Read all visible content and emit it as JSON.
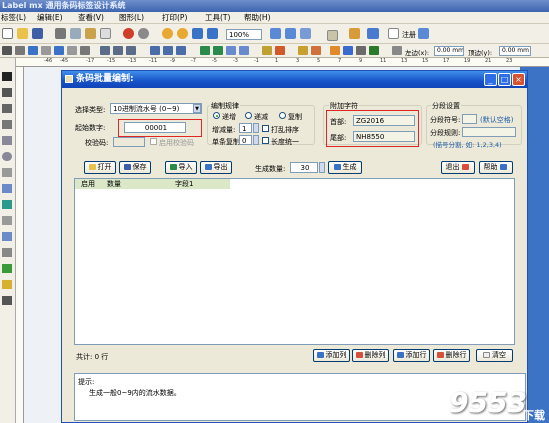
{
  "app": {
    "title": "Label mx 通用条码标签设计系统",
    "menus": [
      "标签(L)",
      "编辑(E)",
      "查看(V)",
      "图形(L)",
      "打印(P)",
      "工具(T)",
      "帮助(H)"
    ],
    "zoom": "100%",
    "register_label": "注册",
    "left_label": "左边(x):",
    "left_value": "0.00 mm",
    "top_label": "顶边(y):",
    "top_value": "0.00 mm",
    "ruler_ticks": [
      "-46",
      "-45",
      "-17",
      "-15",
      "-13",
      "-11",
      "-9",
      "-7",
      "-5",
      "-3",
      "-1",
      "1",
      "3",
      "5",
      "7",
      "9",
      "11",
      "13",
      "15",
      "17",
      "19",
      "21",
      "23"
    ]
  },
  "dialog": {
    "title": "条码批量编制:",
    "seq_type_label": "选择类型:",
    "seq_type_value": "10进制流水号 (0~9)",
    "start_label": "起始数字:",
    "start_value": "00001",
    "check_label": "校验码:",
    "enable_check_label": "启用校验码",
    "rule_group": "编制规律",
    "rule_options": [
      "递增",
      "递减",
      "复制"
    ],
    "step_label": "增减量:",
    "step_value": "1",
    "repeat_label": "单条复制",
    "repeat_value": "0",
    "shuffle_label": "打乱排序",
    "length_label": "长度统一",
    "affix_group": "附加字符",
    "prefix_label": "首部:",
    "prefix_value": "ZG2016",
    "suffix_label": "尾部:",
    "suffix_value": "NH8550",
    "segment_group": "分段设置",
    "seg_char_label": "分段符号:",
    "seg_char_hint": "(默认空格)",
    "seg_rule_label": "分段规则:",
    "seg_rule_hint": "(描号分割, 如: 1,2,3,4)",
    "btn_open": "打开",
    "btn_save": "保存",
    "btn_import": "导入",
    "btn_export": "导出",
    "gen_count_label": "生成数量:",
    "gen_count_value": "30",
    "btn_generate": "生成",
    "btn_exit": "退出",
    "btn_help": "帮助",
    "grid_headers": [
      "启用",
      "数量",
      "字段1"
    ],
    "total_label": "共计: 0 行",
    "btn_add_col": "添加列",
    "btn_del_col": "删除列",
    "btn_add_row": "添加行",
    "btn_del_row": "删除行",
    "btn_clear": "清空",
    "hint_title": "提示:",
    "hint_text": "生成一般0~9内的流水数据。"
  },
  "watermark": "9553",
  "watermark_sub": "下载"
}
